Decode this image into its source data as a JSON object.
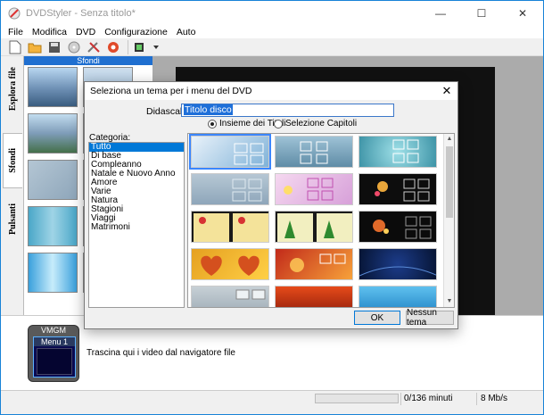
{
  "window": {
    "title": "DVDStyler - Senza titolo*",
    "controls": {
      "minimize": "—",
      "maximize": "☐",
      "close": "✕"
    }
  },
  "menu": [
    "File",
    "Modifica",
    "DVD",
    "Configurazione",
    "Auto"
  ],
  "tabs": [
    "Esplora file",
    "Sfondi",
    "Pulsanti"
  ],
  "panel": {
    "title": "Sfondi"
  },
  "timeline": {
    "vmgm": "VMGM",
    "menu1": "Menu 1",
    "drop_hint": "Trascina qui i video dal navigatore file"
  },
  "status": {
    "minutes": "0/136 minuti",
    "rate": "8 Mb/s",
    "progress": 0
  },
  "dialog": {
    "title": "Seleziona un tema per i menu del DVD",
    "close": "✕",
    "caption_label": "Didascalia:",
    "caption_value": "Titolo disco",
    "radio_titles": "Insieme dei Titoli",
    "radio_chapters": "Selezione Capitoli",
    "category_label": "Categoria:",
    "categories": [
      "Tutto",
      "Di base",
      "Compleanno",
      "Natale e Nuovo Anno",
      "Amore",
      "Varie",
      "Natura",
      "Stagioni",
      "Viaggi",
      "Matrimoni"
    ],
    "ok": "OK",
    "no_theme": "Nessun tema"
  },
  "colors": {
    "accent": "#0078d7",
    "panel_header": "#1f6fd0"
  }
}
